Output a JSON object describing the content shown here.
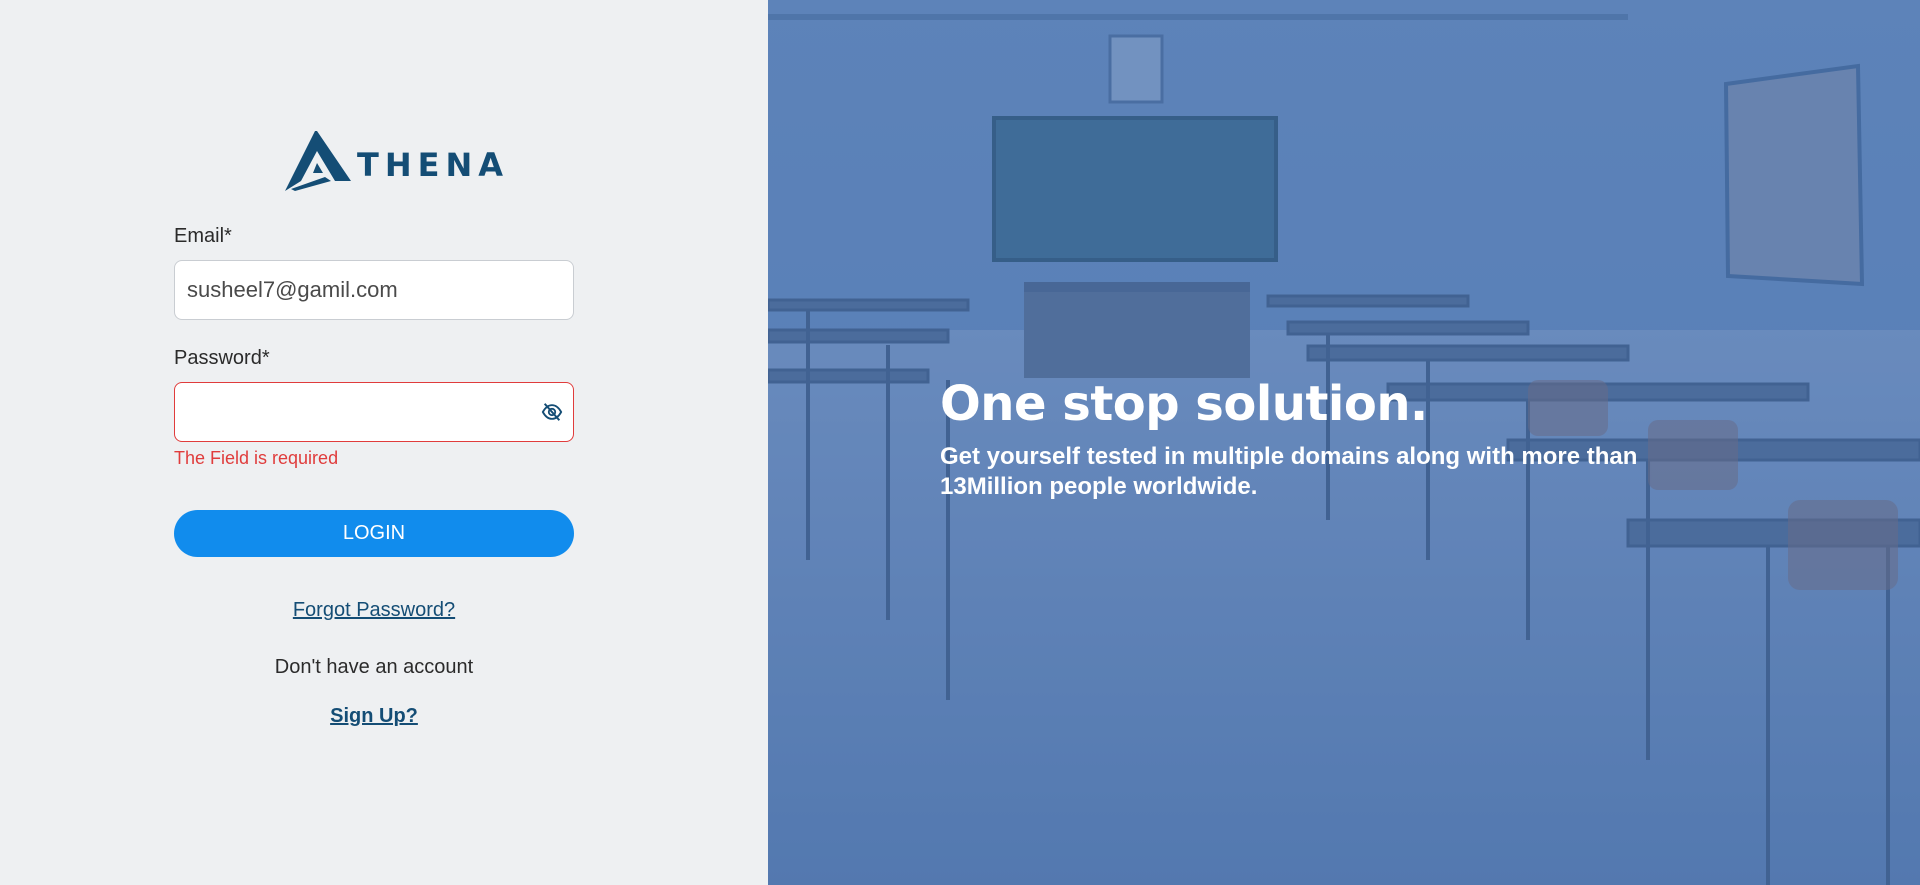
{
  "brand": {
    "name": "THENA",
    "primary_color": "#144d75",
    "accent_color": "#118ced",
    "error_color": "#e03c3c"
  },
  "login_form": {
    "email_label": "Email*",
    "email_value": "susheel7@gamil.com",
    "password_label": "Password*",
    "password_value": "",
    "password_toggle_icon": "eye-off-icon",
    "password_error": "The Field is required",
    "login_button": "LOGIN",
    "forgot_link": "Forgot Password?",
    "no_account_text": "Don't have an account",
    "signup_link": "Sign Up?"
  },
  "hero": {
    "title": "One stop solution.",
    "subtitle": "Get yourself tested in multiple domains along with more than 13Million people worldwide."
  }
}
